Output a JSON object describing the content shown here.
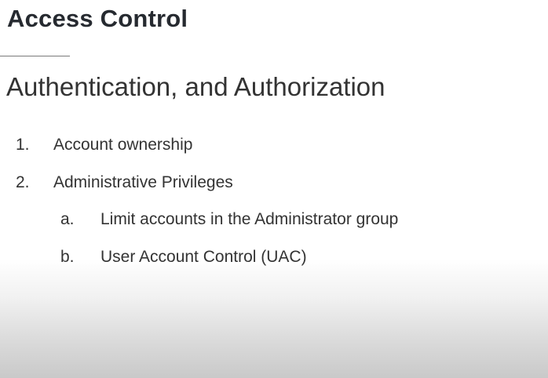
{
  "slide": {
    "title": "Access Control",
    "subtitle": "Authentication, and Authorization",
    "items": [
      {
        "marker": "1.",
        "text": "Account ownership"
      },
      {
        "marker": "2.",
        "text": "Administrative Privileges",
        "subitems": [
          {
            "marker": "a.",
            "text": "Limit accounts in the Administrator group"
          },
          {
            "marker": "b.",
            "text": "User Account Control (UAC)"
          }
        ]
      }
    ]
  }
}
